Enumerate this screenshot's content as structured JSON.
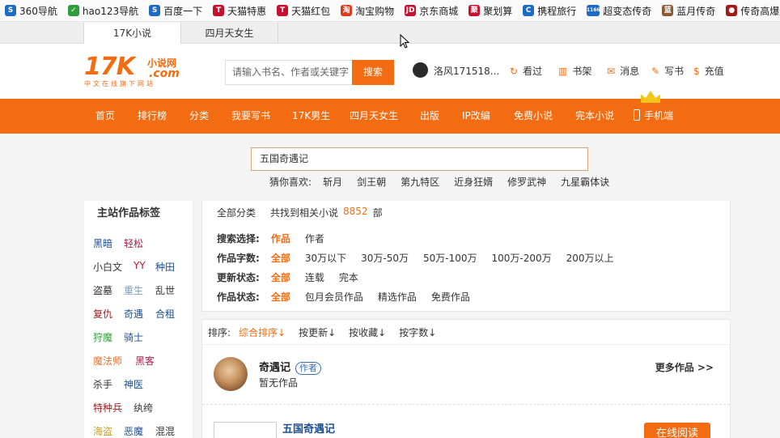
{
  "bookmarks": [
    {
      "label": "360导航",
      "icon": "360-globe-icon",
      "color": "#1e6bc4",
      "glyph": "S"
    },
    {
      "label": "hao123导航",
      "icon": "hao123-icon",
      "color": "#2f9e3a",
      "glyph": "✓"
    },
    {
      "label": "百度一下",
      "icon": "baidu-icon",
      "color": "#1e6bc4",
      "glyph": "S"
    },
    {
      "label": "天猫特惠",
      "icon": "tmall-icon",
      "color": "#c8102e",
      "glyph": "T"
    },
    {
      "label": "天猫红包",
      "icon": "tmall-icon",
      "color": "#c8102e",
      "glyph": "T"
    },
    {
      "label": "淘宝购物",
      "icon": "taobao-icon",
      "color": "#e03a1e",
      "glyph": "淘"
    },
    {
      "label": "京东商城",
      "icon": "jd-icon",
      "color": "#c8102e",
      "glyph": "JD"
    },
    {
      "label": "聚划算",
      "icon": "juhuasuan-icon",
      "color": "#c8102e",
      "glyph": "聚"
    },
    {
      "label": "携程旅行",
      "icon": "ctrip-icon",
      "color": "#1e6bc4",
      "glyph": "C"
    },
    {
      "label": "超变态传奇",
      "icon": "game-1166-icon",
      "color": "#1e6bc4",
      "glyph": "1166"
    },
    {
      "label": "蓝月传奇",
      "icon": "game-avatar-icon",
      "color": "#8a5a35",
      "glyph": "蓝"
    },
    {
      "label": "传奇高爆版",
      "icon": "game-icon",
      "color": "#a01a1a",
      "glyph": "●"
    }
  ],
  "tabs": [
    "17K小说",
    "四月天女生"
  ],
  "logo": {
    "main": "17K",
    "cn": "小说网",
    "com": ".com",
    "sub": "中文在线旗下网站"
  },
  "header": {
    "search_placeholder": "请输入书名、作者或关键字",
    "search_button": "搜索",
    "username": "洛风171518...",
    "links": [
      {
        "label": "看过",
        "icon": "history-icon",
        "glyph": "↻"
      },
      {
        "label": "书架",
        "icon": "bookshelf-icon",
        "glyph": "▥"
      },
      {
        "label": "消息",
        "icon": "message-icon",
        "glyph": "✉"
      },
      {
        "label": "写书",
        "icon": "write-icon",
        "glyph": "✎"
      },
      {
        "label": "充值",
        "icon": "recharge-icon",
        "glyph": "$"
      }
    ]
  },
  "nav": [
    "首页",
    "排行榜",
    "分类",
    "我要写书",
    "17K男生",
    "四月天女生",
    "出版",
    "IP改编",
    "免费小说",
    "完本小说",
    "手机端"
  ],
  "search": {
    "value": "五国奇遇记",
    "guess_label": "猜你喜欢:",
    "guess_items": [
      "斩月",
      "剑王朝",
      "第九特区",
      "近身狂婿",
      "修罗武神",
      "九星霸体诀"
    ]
  },
  "sidebar": {
    "title": "主站作品标签",
    "tags": [
      {
        "label": "黑暗",
        "color": "#1d4f91"
      },
      {
        "label": "轻松",
        "color": "#a5204f"
      },
      {
        "label": "小白文",
        "color": "#333333"
      },
      {
        "label": "YY",
        "color": "#c8102e"
      },
      {
        "label": "种田",
        "color": "#1d4f91"
      },
      {
        "label": "盗墓",
        "color": "#333333"
      },
      {
        "label": "重生",
        "color": "#7a9cc0"
      },
      {
        "label": "乱世",
        "color": "#333333"
      },
      {
        "label": "复仇",
        "color": "#a01a1a"
      },
      {
        "label": "奇遇",
        "color": "#1d4f91"
      },
      {
        "label": "合租",
        "color": "#1d4f91"
      },
      {
        "label": "狩魔",
        "color": "#2f9e3a"
      },
      {
        "label": "骑士",
        "color": "#1d4f91"
      },
      {
        "label": "魔法师",
        "color": "#e0783a"
      },
      {
        "label": "黑客",
        "color": "#a5204f"
      },
      {
        "label": "杀手",
        "color": "#333333"
      },
      {
        "label": "神医",
        "color": "#1d4f91"
      },
      {
        "label": "特种兵",
        "color": "#a01a1a"
      },
      {
        "label": "纨绔",
        "color": "#333333"
      },
      {
        "label": "海盗",
        "color": "#c9a227"
      },
      {
        "label": "恶魔",
        "color": "#1d4f91"
      },
      {
        "label": "混混",
        "color": "#333333"
      }
    ]
  },
  "filters": {
    "all_category": "全部分类",
    "count_prefix": "共找到相关小说",
    "count": "8852",
    "count_suffix": "部",
    "rows": [
      {
        "label": "搜索选择:",
        "options": [
          "作品",
          "作者"
        ]
      },
      {
        "label": "作品字数:",
        "options": [
          "全部",
          "30万以下",
          "30万-50万",
          "50万-100万",
          "100万-200万",
          "200万以上"
        ]
      },
      {
        "label": "更新状态:",
        "options": [
          "全部",
          "连载",
          "完本"
        ]
      },
      {
        "label": "作品状态:",
        "options": [
          "全部",
          "包月会员作品",
          "精选作品",
          "免费作品"
        ]
      }
    ]
  },
  "sort": {
    "label": "排序:",
    "items": [
      "综合排序↓",
      "按更新↓",
      "按收藏↓",
      "按字数↓"
    ]
  },
  "author": {
    "name": "奇遇记",
    "badge": "作者",
    "works": "暂无作品",
    "more": "更多作品 >>"
  },
  "book": {
    "title": "五国奇遇记",
    "read_button": "在线阅读"
  },
  "colors": {
    "accent": "#f36c12",
    "link_blue": "#1d4f91"
  }
}
